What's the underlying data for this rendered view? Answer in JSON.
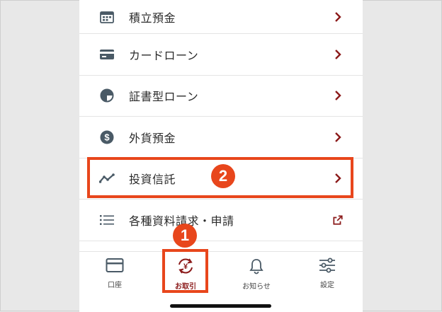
{
  "menu": {
    "items": [
      {
        "label": "積立預金",
        "icon": "calendar-icon",
        "action": "chevron-right-icon"
      },
      {
        "label": "カードローン",
        "icon": "card-icon",
        "action": "chevron-right-icon"
      },
      {
        "label": "証書型ローン",
        "icon": "half-circle-icon",
        "action": "chevron-right-icon"
      },
      {
        "label": "外貨預金",
        "icon": "dollar-circle-icon",
        "action": "chevron-right-icon"
      },
      {
        "label": "投資信託",
        "icon": "trend-line-icon",
        "action": "chevron-right-icon"
      },
      {
        "label": "各種資料請求・申請",
        "icon": "list-icon",
        "action": "external-link-icon"
      }
    ]
  },
  "tabbar": {
    "tabs": [
      {
        "label": "口座",
        "icon": "card-outline-icon"
      },
      {
        "label": "お取引",
        "icon": "yen-exchange-icon",
        "active": true
      },
      {
        "label": "お知らせ",
        "icon": "bell-icon"
      },
      {
        "label": "設定",
        "icon": "sliders-icon"
      }
    ]
  },
  "annotations": {
    "badge1": "1",
    "badge2": "2"
  },
  "colors": {
    "accent": "#8b1a1a",
    "highlight": "#e8461c",
    "icon": "#4a5a66"
  }
}
